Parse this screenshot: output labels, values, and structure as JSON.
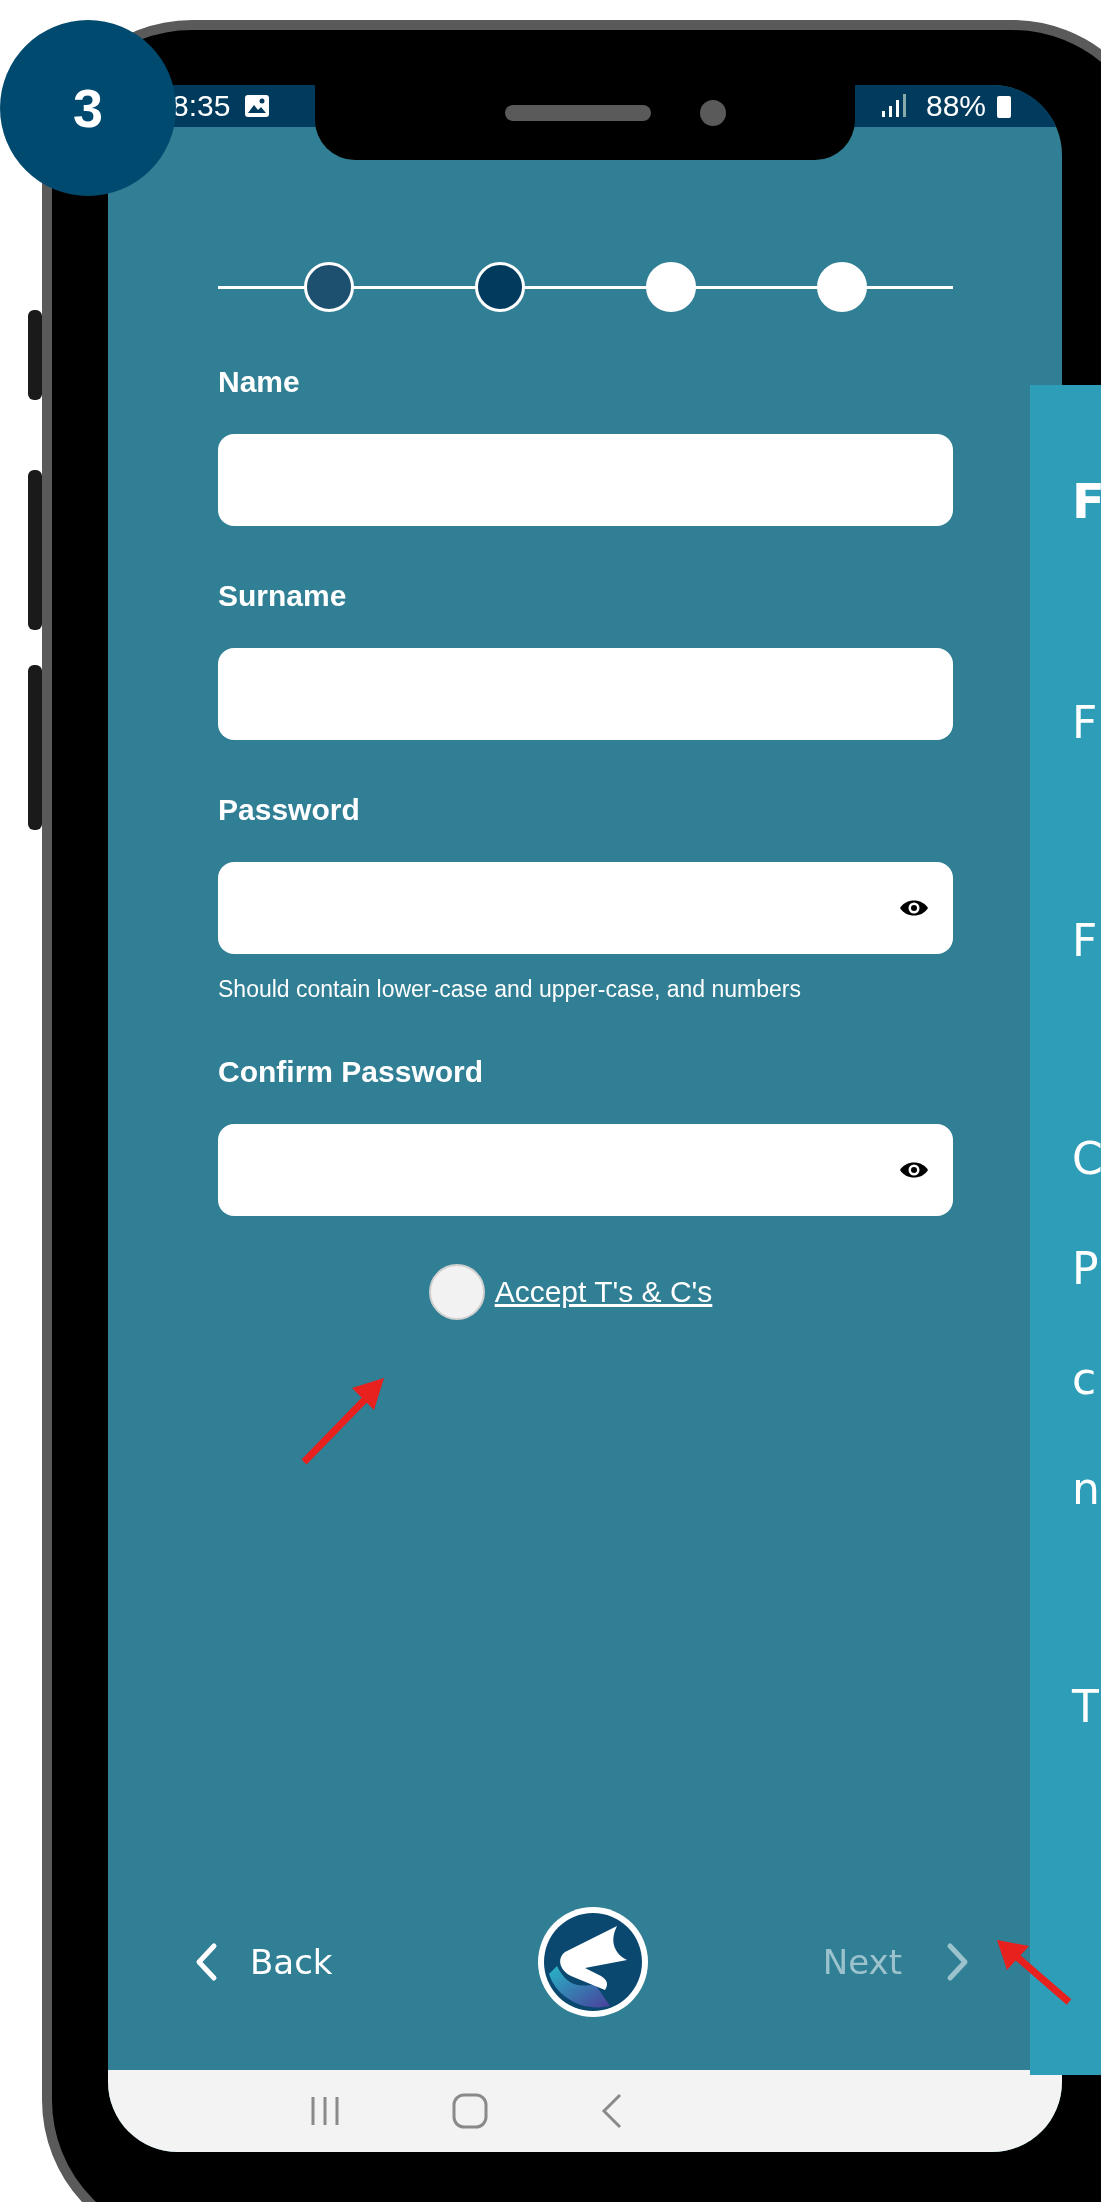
{
  "badge": "3",
  "status_bar": {
    "time": "8:35",
    "battery": "88%"
  },
  "stepper": [
    {
      "completed": true,
      "selected": false
    },
    {
      "completed": false,
      "selected": true
    },
    {
      "completed": false,
      "selected": false
    },
    {
      "completed": false,
      "selected": false
    }
  ],
  "fields": [
    {
      "label": "Name",
      "kind": "text"
    },
    {
      "label": "Surname",
      "kind": "text"
    },
    {
      "label": "Password",
      "kind": "password",
      "hint": "Should contain lower-case and upper-case, and numbers"
    },
    {
      "label": "Confirm Password",
      "kind": "password"
    }
  ],
  "terms": {
    "label": "Accept T's & C's",
    "checked": false
  },
  "footer": {
    "back": "Back",
    "next": {
      "label": "Next",
      "disabled": true
    }
  },
  "callout": {
    "heading": "F",
    "paragraphs": [
      [
        "F"
      ],
      [
        "F"
      ],
      [
        "C",
        "P",
        "c",
        "n"
      ],
      [
        "T"
      ]
    ]
  }
}
